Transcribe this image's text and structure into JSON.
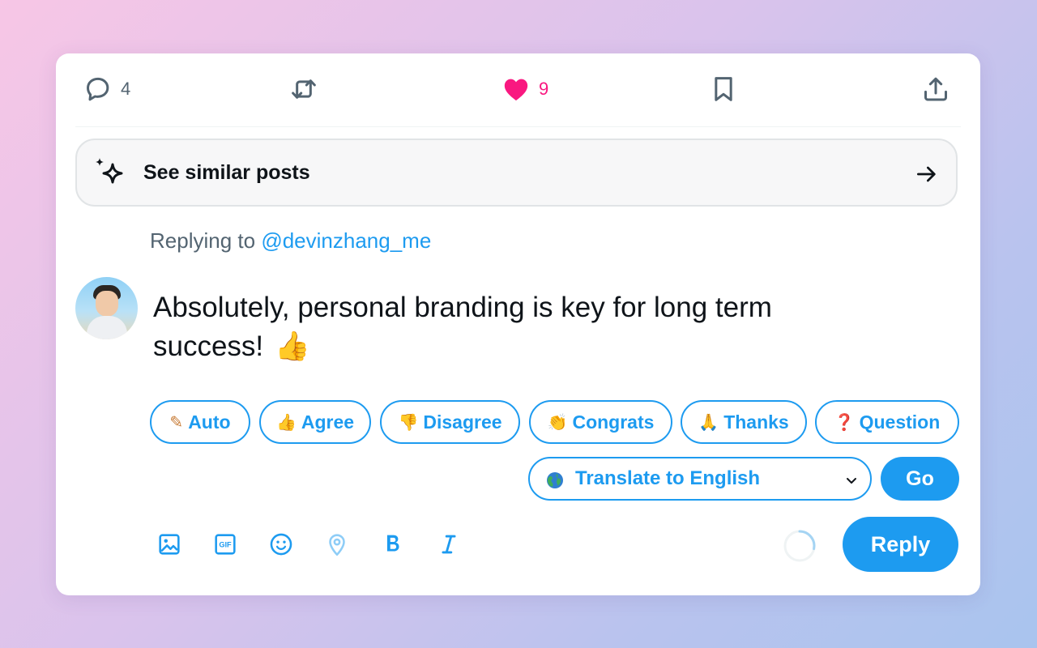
{
  "actions": {
    "reply_count": "4",
    "like_count": "9"
  },
  "similar": {
    "label": "See similar posts"
  },
  "replying": {
    "prefix": "Replying to ",
    "handle": "@devinzhang_me"
  },
  "compose": {
    "text": "Absolutely, personal branding is key for long term success!",
    "emoji": "👍"
  },
  "chips": [
    {
      "icon": "✎",
      "label": "Auto"
    },
    {
      "icon": "👍",
      "label": "Agree"
    },
    {
      "icon": "👎",
      "label": "Disagree"
    },
    {
      "icon": "👏",
      "label": "Congrats"
    },
    {
      "icon": "🙏",
      "label": "Thanks"
    },
    {
      "icon": "❓",
      "label": "Question"
    }
  ],
  "translate": {
    "selected": "Translate to English",
    "go_label": "Go"
  },
  "reply_button": {
    "label": "Reply"
  },
  "colors": {
    "accent": "#1d9bf0",
    "like": "#f91880",
    "text": "#0f1419",
    "muted": "#536471"
  },
  "icons": {
    "toolbar": [
      "image-icon",
      "gif-icon",
      "emoji-icon",
      "location-icon",
      "bold-icon",
      "italic-icon"
    ]
  }
}
